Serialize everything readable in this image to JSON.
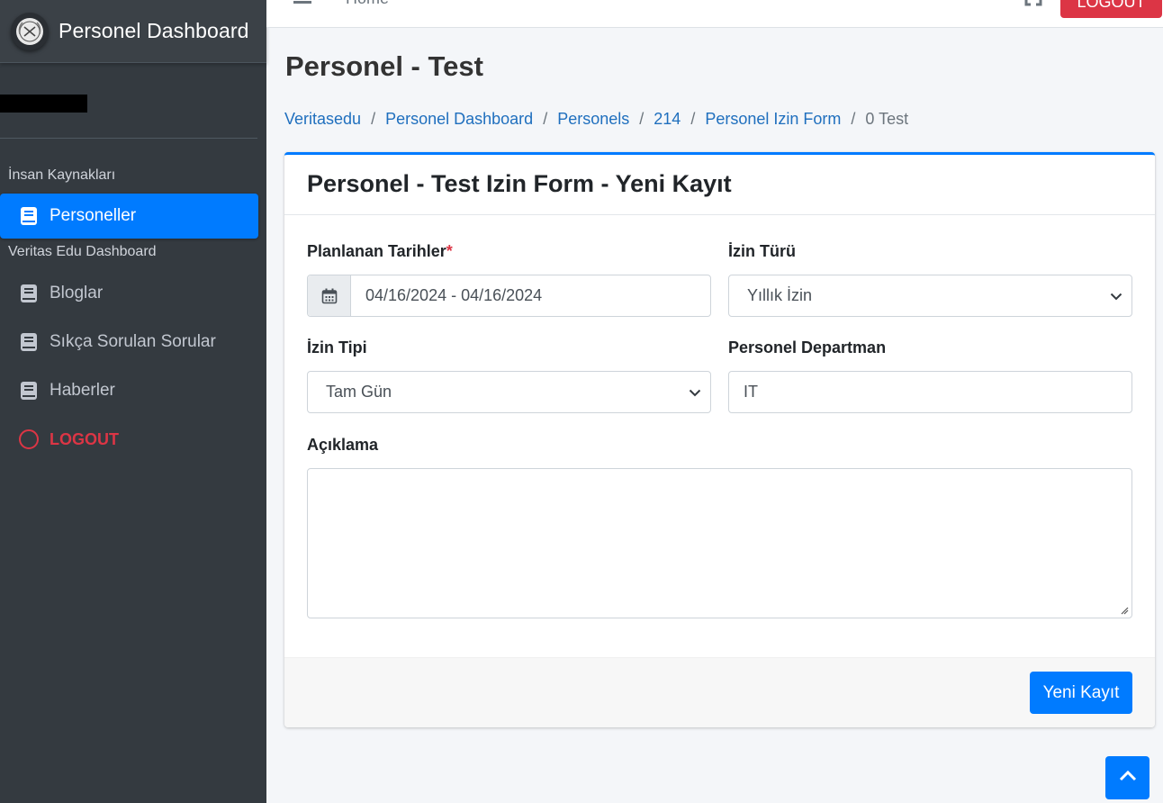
{
  "app": {
    "brand_name": "Personel Dashboard"
  },
  "topbar": {
    "home_link": "Home",
    "logout_label": "LOGOUT"
  },
  "sidebar": {
    "sections": [
      {
        "header": "İnsan Kaynakları"
      },
      {
        "header": "Veritas Edu Dashboard"
      }
    ],
    "items": [
      {
        "label": "Personeller",
        "icon": "book-icon",
        "active": true
      },
      {
        "label": "Bloglar",
        "icon": "book-icon"
      },
      {
        "label": "Sıkça Sorulan Sorular",
        "icon": "book-icon"
      },
      {
        "label": "Haberler",
        "icon": "book-icon"
      },
      {
        "label": "LOGOUT",
        "icon": "circle-icon"
      }
    ]
  },
  "page": {
    "title": "Personel - Test",
    "breadcrumb": [
      "Veritasedu",
      "Personel Dashboard",
      "Personels",
      "214",
      "Personel Izin Form",
      "0 Test"
    ]
  },
  "form": {
    "card_title": "Personel - Test Izin Form - Yeni Kayıt",
    "planned_dates_label": "Planlanan Tarihler",
    "required_mark": "*",
    "planned_dates_value": "04/16/2024 - 04/16/2024",
    "leave_kind_label": "İzin Türü",
    "leave_kind_value": "Yıllık İzin",
    "leave_type_label": "İzin Tipi",
    "leave_type_value": "Tam Gün",
    "department_label": "Personel Departman",
    "department_value": "IT",
    "description_label": "Açıklama",
    "description_value": "",
    "submit_label": "Yeni Kayıt"
  },
  "colors": {
    "primary": "#007bff",
    "danger": "#dc3545",
    "sidebar_bg": "#343a40"
  }
}
